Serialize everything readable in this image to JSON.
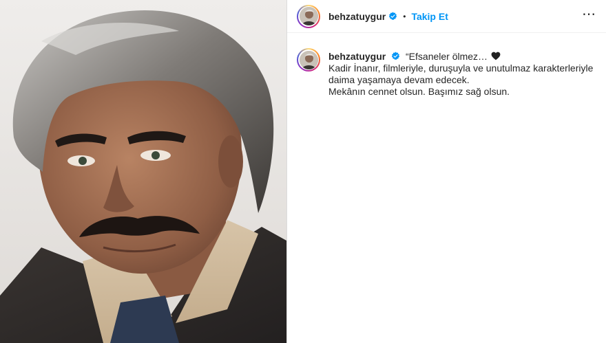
{
  "header": {
    "username": "behzatuygur",
    "separator": "•",
    "follow_label": "Takip Et",
    "more_label": "⋯",
    "verified_icon": "verified-badge-icon"
  },
  "caption": {
    "username": "behzatuygur",
    "first_line": "“Efsaneler ölmez…",
    "emoji": "black-heart-icon",
    "lines": [
      "Kadir İnanır, filmleriyle, duruşuyla ve unutulmaz karakterleriyle",
      "daima yaşamaya devam edecek.",
      "Mekânın cennet olsun. Başımız sağ olsun."
    ]
  },
  "colors": {
    "accent": "#0095f6",
    "text": "#262626",
    "verified": "#0095f6"
  }
}
